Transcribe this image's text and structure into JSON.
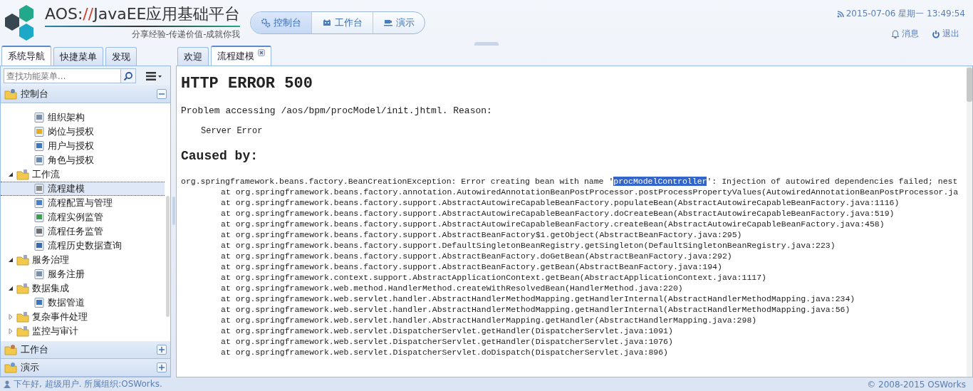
{
  "header": {
    "title": [
      {
        "text": "AOS:",
        "accent": false
      },
      {
        "text": "//",
        "accent": true
      },
      {
        "text": "JavaEE应用基础平台",
        "accent": false
      }
    ],
    "slogan": "分享经验-传递价值-成就你我",
    "nav": [
      {
        "label": "控制台",
        "selected": true
      },
      {
        "label": "工作台",
        "selected": false
      },
      {
        "label": "演示",
        "selected": false
      }
    ],
    "datetime": "2015-07-06 星期一 13:49:54",
    "messages": "消息",
    "logout": "退出"
  },
  "sidebar": {
    "tabs": [
      {
        "label": "系统导航",
        "selected": true
      },
      {
        "label": "快捷菜单",
        "selected": false
      },
      {
        "label": "发现",
        "selected": false
      }
    ],
    "search": {
      "placeholder": "查找功能菜单..."
    },
    "sections": [
      {
        "label": "控制台",
        "expanded": true,
        "tree": [
          {
            "children": [
              {
                "label": "组织架构",
                "selected": false
              },
              {
                "label": "岗位与授权",
                "selected": false
              },
              {
                "label": "用户与授权",
                "selected": false
              },
              {
                "label": "角色与授权",
                "selected": false
              }
            ]
          },
          {
            "label": "工作流",
            "expanded": true,
            "selected": false,
            "children": [
              {
                "label": "流程建模",
                "selected": true
              },
              {
                "label": "流程配置与管理",
                "selected": false
              },
              {
                "label": "流程实例监管",
                "selected": false
              },
              {
                "label": "流程任务监管",
                "selected": false
              },
              {
                "label": "流程历史数据查询",
                "selected": false
              }
            ]
          },
          {
            "label": "服务治理",
            "expanded": true,
            "selected": false,
            "children": [
              {
                "label": "服务注册",
                "selected": false
              }
            ]
          },
          {
            "label": "数据集成",
            "expanded": true,
            "selected": false,
            "children": [
              {
                "label": "数据管道",
                "selected": false
              }
            ]
          },
          {
            "label": "复杂事件处理",
            "expanded": false,
            "selected": false
          },
          {
            "label": "监控与审计",
            "expanded": false,
            "selected": false
          }
        ]
      },
      {
        "label": "工作台",
        "expanded": false
      },
      {
        "label": "演示",
        "expanded": false
      }
    ]
  },
  "tabs": [
    {
      "label": "欢迎",
      "selected": false,
      "closable": false
    },
    {
      "label": "流程建模",
      "selected": true,
      "closable": true
    }
  ],
  "page": {
    "heading": "HTTP ERROR 500",
    "problem": "Problem accessing /aos/bpm/procModel/init.jhtml. Reason:",
    "reason": "Server Error",
    "caused_by": "Caused by:",
    "exception": {
      "before": "org.springframework.beans.factory.BeanCreationException: Error creating bean with name '",
      "selected": "procModelController",
      "after": "': Injection of autowired dependencies failed; nest"
    },
    "trace": [
      "at org.springframework.beans.factory.annotation.AutowiredAnnotationBeanPostProcessor.postProcessPropertyValues(AutowiredAnnotationBeanPostProcessor.ja",
      "at org.springframework.beans.factory.support.AbstractAutowireCapableBeanFactory.populateBean(AbstractAutowireCapableBeanFactory.java:1116)",
      "at org.springframework.beans.factory.support.AbstractAutowireCapableBeanFactory.doCreateBean(AbstractAutowireCapableBeanFactory.java:519)",
      "at org.springframework.beans.factory.support.AbstractAutowireCapableBeanFactory.createBean(AbstractAutowireCapableBeanFactory.java:458)",
      "at org.springframework.beans.factory.support.AbstractBeanFactory$1.getObject(AbstractBeanFactory.java:295)",
      "at org.springframework.beans.factory.support.DefaultSingletonBeanRegistry.getSingleton(DefaultSingletonBeanRegistry.java:223)",
      "at org.springframework.beans.factory.support.AbstractBeanFactory.doGetBean(AbstractBeanFactory.java:292)",
      "at org.springframework.beans.factory.support.AbstractBeanFactory.getBean(AbstractBeanFactory.java:194)",
      "at org.springframework.context.support.AbstractApplicationContext.getBean(AbstractApplicationContext.java:1117)",
      "at org.springframework.web.method.HandlerMethod.createWithResolvedBean(HandlerMethod.java:220)",
      "at org.springframework.web.servlet.handler.AbstractHandlerMethodMapping.getHandlerInternal(AbstractHandlerMethodMapping.java:234)",
      "at org.springframework.web.servlet.handler.AbstractHandlerMethodMapping.getHandlerInternal(AbstractHandlerMethodMapping.java:56)",
      "at org.springframework.web.servlet.handler.AbstractHandlerMapping.getHandler(AbstractHandlerMapping.java:298)",
      "at org.springframework.web.servlet.DispatcherServlet.getHandler(DispatcherServlet.java:1091)",
      "at org.springframework.web.servlet.DispatcherServlet.getHandler(DispatcherServlet.java:1076)",
      "at org.springframework.web.servlet.DispatcherServlet.doDispatch(DispatcherServlet.java:896)"
    ]
  },
  "status_bar": {
    "greeting": "下午好, 超级用户. 所属组织:OSWorks.",
    "copyright": "© 2008-2015 OSWorks"
  }
}
